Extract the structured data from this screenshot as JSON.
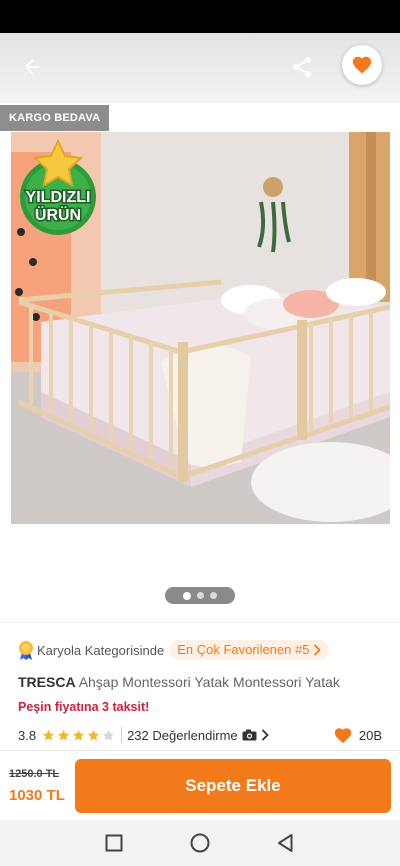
{
  "header": {
    "back_icon": "arrow-left-icon",
    "share_icon": "share-icon",
    "favorite_icon": "heart-icon"
  },
  "badges": {
    "cargo": "KARGO BEDAVA",
    "star_line1": "YILDIZLI",
    "star_line2": "ÜRÜN"
  },
  "gallery": {
    "page_count": 3,
    "active_index": 0
  },
  "product": {
    "category_text": "Karyola Kategorisinde",
    "favorite_chip": "En Çok Favorilenen #5",
    "brand": "TRESCA",
    "name": "Ahşap Montessori Yatak Montessori Yatak",
    "installment": "Peşin fiyatına 3 taksit!",
    "rating": "3.8",
    "rating_value": 3.8,
    "reviews": "232 Değerlendirme",
    "likes": "20B"
  },
  "buy_bar": {
    "old_price": "1250.0 TL",
    "price": "1030 TL",
    "add_to_cart": "Sepete Ekle"
  },
  "colors": {
    "accent": "#f27a1a",
    "installment": "#d21f3c",
    "star_badge_green": "#2e9a3c"
  },
  "nav": {
    "square_icon": "recent-apps-icon",
    "circle_icon": "home-icon",
    "triangle_icon": "back-triangle-icon"
  }
}
